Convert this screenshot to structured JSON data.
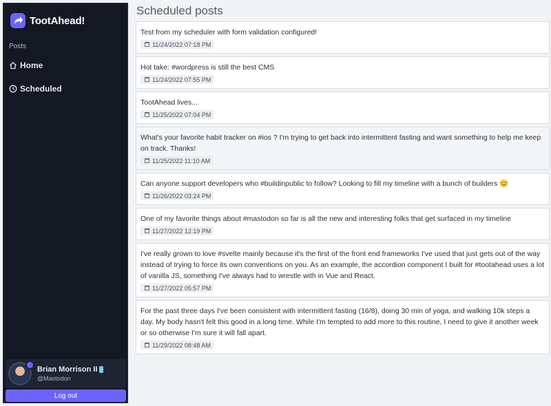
{
  "app": {
    "name": "TootAhead!"
  },
  "nav": {
    "heading": "Posts",
    "items": [
      {
        "label": "Home",
        "icon": "house-icon"
      },
      {
        "label": "Scheduled",
        "icon": "clock-icon"
      }
    ]
  },
  "user": {
    "name": "Brian Morrison II",
    "handle": "@Mastodon"
  },
  "logout_label": "Log out",
  "page": {
    "title": "Scheduled posts"
  },
  "posts": [
    {
      "text": "Test from my scheduler with form validation configured!",
      "date": "11/24/2022 07:18 PM"
    },
    {
      "text": "Hot take: #wordpress is still the best CMS",
      "date": "11/24/2022 07:55 PM"
    },
    {
      "text": "TootAhead lives...",
      "date": "11/25/2022 07:04 PM"
    },
    {
      "text": "What's your favorite habit tracker on #ios ? I'm trying to get back into intermittent fasting and want something to help me keep on track. Thanks!",
      "date": "11/25/2022 11:10 AM"
    },
    {
      "text": "Can anyone support developers who #buildinpublic to follow? Looking to fill my timeline with a bunch of builders 😊",
      "date": "11/26/2022 03:24 PM"
    },
    {
      "text": "One of my favorite things about #mastodon so far is all the new and interesting folks that get surfaced in my timeline",
      "date": "11/27/2022 12:19 PM"
    },
    {
      "text": "I've really grown to love #svelte mainly because it's the first of the front end frameworks I've used that just gets out of the way instead of trying to force its own conventions on you. As an example, the accordion component I built for #tootahead uses a lot of vanilla JS, something I've always had to wrestle with in Vue and React.",
      "date": "11/27/2022 05:57 PM"
    },
    {
      "text": "For the past three days I've been consistent with intermittent fasting (16/8), doing 30 min of yoga, and walking 10k steps a day. My body hasn't felt this good in a long time. While I'm tempted to add more to this routine, I need to give it another week or so otherwise I'm sure it will fall apart.",
      "date": "11/29/2022 08:48 AM"
    }
  ],
  "colors": {
    "accent": "#6c63ff",
    "sidebar": "#141823",
    "background": "#f1f3f5"
  }
}
